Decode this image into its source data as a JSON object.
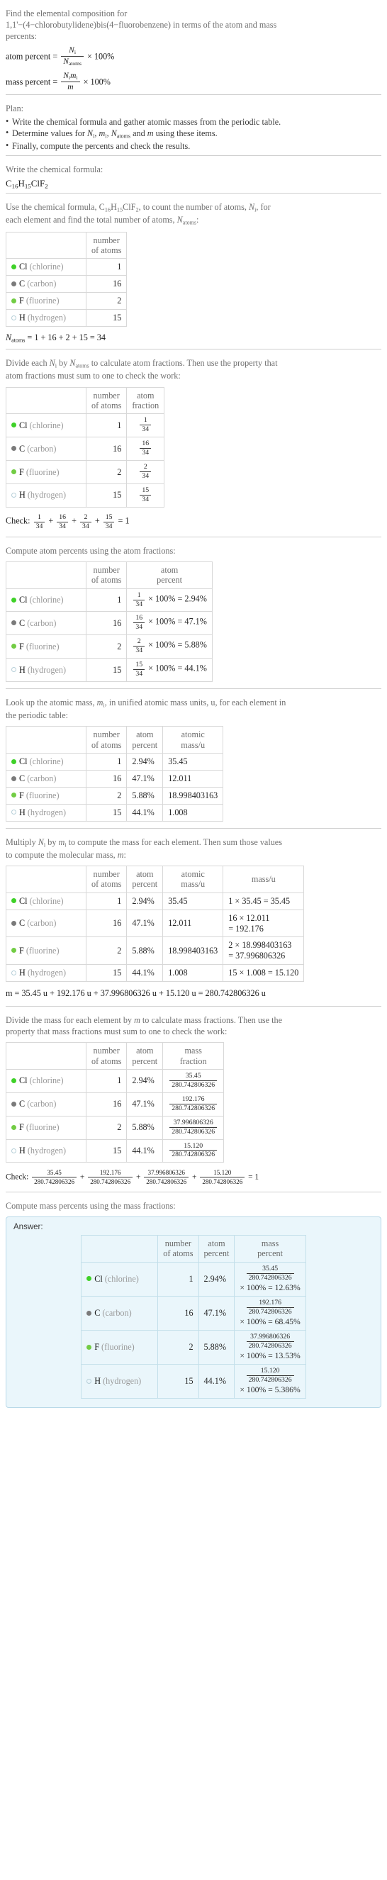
{
  "problem": {
    "intro_line1": "Find the elemental composition for",
    "intro_line2": "1,1'−(4−chlorobutylidene)bis(4−fluorobenzene) in terms of the atom and mass",
    "intro_line3": "percents:",
    "atom_percent_label": "atom percent =",
    "mass_percent_label": "mass percent =",
    "times100": "× 100%"
  },
  "plan": {
    "heading": "Plan:",
    "items": [
      "Write the chemical formula and gather atomic masses from the periodic table.",
      "Determine values for Nᵢ, mᵢ, Nₐₜₒₘₛ and m using these items.",
      "Finally, compute the percents and check the results."
    ]
  },
  "formula_section": {
    "prompt": "Write the chemical formula:",
    "formula": "C16H15ClF2"
  },
  "count_section": {
    "prompt_a": "Use the chemical formula, C",
    "prompt_b": ", to count the number of atoms, ",
    "prompt_c": ", for",
    "prompt_line2": "each element and find the total number of atoms, ",
    "total_text": "= 1 + 16 + 2 + 15 = 34"
  },
  "fraction_section": {
    "prompt_line1": "Divide each Nᵢ by Nₐₜₒₘₛ to calculate atom fractions. Then use the property that",
    "prompt_line2": "atom fractions must sum to one to check the work:",
    "check_label": "Check:",
    "check_terms": [
      "1/34",
      "16/34",
      "2/34",
      "15/34"
    ],
    "check_result": "= 1",
    "denominator": "34"
  },
  "atom_percent_section": {
    "prompt": "Compute atom percents using the atom fractions:"
  },
  "mass_lookup_section": {
    "prompt_line1": "Look up the atomic mass, mᵢ, in unified atomic mass units, u, for each element in",
    "prompt_line2": "the periodic table:"
  },
  "multiply_section": {
    "prompt_line1": "Multiply Nᵢ by mᵢ to compute the mass for each element. Then sum those values",
    "prompt_line2": "to compute the molecular mass, m:",
    "total_mass_line": "m = 35.45 u + 192.176 u + 37.996806326 u + 15.120 u = 280.742806326 u"
  },
  "mass_fraction_section": {
    "prompt_line1": "Divide the mass for each element by m to calculate mass fractions. Then use the",
    "prompt_line2": "property that mass fractions must sum to one to check the work:",
    "check_label": "Check:",
    "check_result": "= 1",
    "denominator": "280.742806326"
  },
  "mass_percent_section": {
    "prompt": "Compute mass percents using the mass fractions:"
  },
  "answer": {
    "label": "Answer:"
  },
  "columns": {
    "blank": "",
    "number_of_atoms_l1": "number",
    "number_of_atoms_l2": "of atoms",
    "atom_fraction_l1": "atom",
    "atom_fraction_l2": "fraction",
    "atom_percent_l1": "atom",
    "atom_percent_l2": "percent",
    "atomic_mass_l1": "atomic",
    "atomic_mass_l2": "mass/u",
    "mass_u": "mass/u",
    "mass_fraction_l1": "mass",
    "mass_fraction_l2": "fraction",
    "mass_percent_l1": "mass",
    "mass_percent_l2": "percent"
  },
  "chart_data": {
    "type": "table",
    "title": "Elemental composition of C16H15ClF2",
    "total_atoms": 34,
    "molecular_mass_u": 280.742806326,
    "elements": [
      {
        "symbol": "Cl",
        "name": "(chlorine)",
        "dot_color": "#3fd128",
        "dot_border": "#3fd128",
        "count": "1",
        "count_num": 1,
        "fraction_num": "1",
        "fraction_den": "34",
        "atom_percent_expr_num": "1",
        "atom_percent_expr_den": "34",
        "atom_percent": "2.94%",
        "atom_percent_eq": "× 100% = 2.94%",
        "atomic_mass": "35.45",
        "mass_calc_line1": "1 × 35.45 = 35.45",
        "mass_calc_line2": "",
        "mass": "35.45",
        "mass_fraction_num": "35.45",
        "mass_fraction_den": "280.742806326",
        "mass_percent_tail": "× 100% = 12.63%",
        "mass_percent": "12.63%"
      },
      {
        "symbol": "C",
        "name": "(carbon)",
        "dot_color": "#7a7a7a",
        "dot_border": "#7a7a7a",
        "count": "16",
        "count_num": 16,
        "fraction_num": "16",
        "fraction_den": "34",
        "atom_percent_expr_num": "16",
        "atom_percent_expr_den": "34",
        "atom_percent": "47.1%",
        "atom_percent_eq": "× 100% = 47.1%",
        "atomic_mass": "12.011",
        "mass_calc_line1": "16 × 12.011",
        "mass_calc_line2": "= 192.176",
        "mass": "192.176",
        "mass_fraction_num": "192.176",
        "mass_fraction_den": "280.742806326",
        "mass_percent_tail": "× 100% = 68.45%",
        "mass_percent": "68.45%"
      },
      {
        "symbol": "F",
        "name": "(fluorine)",
        "dot_color": "#72cc44",
        "dot_border": "#72cc44",
        "count": "2",
        "count_num": 2,
        "fraction_num": "2",
        "fraction_den": "34",
        "atom_percent_expr_num": "2",
        "atom_percent_expr_den": "34",
        "atom_percent": "5.88%",
        "atom_percent_eq": "× 100% = 5.88%",
        "atomic_mass": "18.998403163",
        "mass_calc_line1": "2 × 18.998403163",
        "mass_calc_line2": "= 37.996806326",
        "mass": "37.996806326",
        "mass_fraction_num": "37.996806326",
        "mass_fraction_den": "280.742806326",
        "mass_percent_tail": "× 100% = 13.53%",
        "mass_percent": "13.53%"
      },
      {
        "symbol": "H",
        "name": "(hydrogen)",
        "dot_color": "#eaf6fb",
        "dot_border": "#b6cfd8",
        "count": "15",
        "count_num": 15,
        "fraction_num": "15",
        "fraction_den": "34",
        "atom_percent_expr_num": "15",
        "atom_percent_expr_den": "34",
        "atom_percent": "44.1%",
        "atom_percent_eq": "× 100% = 44.1%",
        "atomic_mass": "1.008",
        "mass_calc_line1": "15 × 1.008 = 15.120",
        "mass_calc_line2": "",
        "mass": "15.120",
        "mass_fraction_num": "15.120",
        "mass_fraction_den": "280.742806326",
        "mass_percent_tail": "× 100% = 5.386%",
        "mass_percent": "5.386%"
      }
    ]
  }
}
